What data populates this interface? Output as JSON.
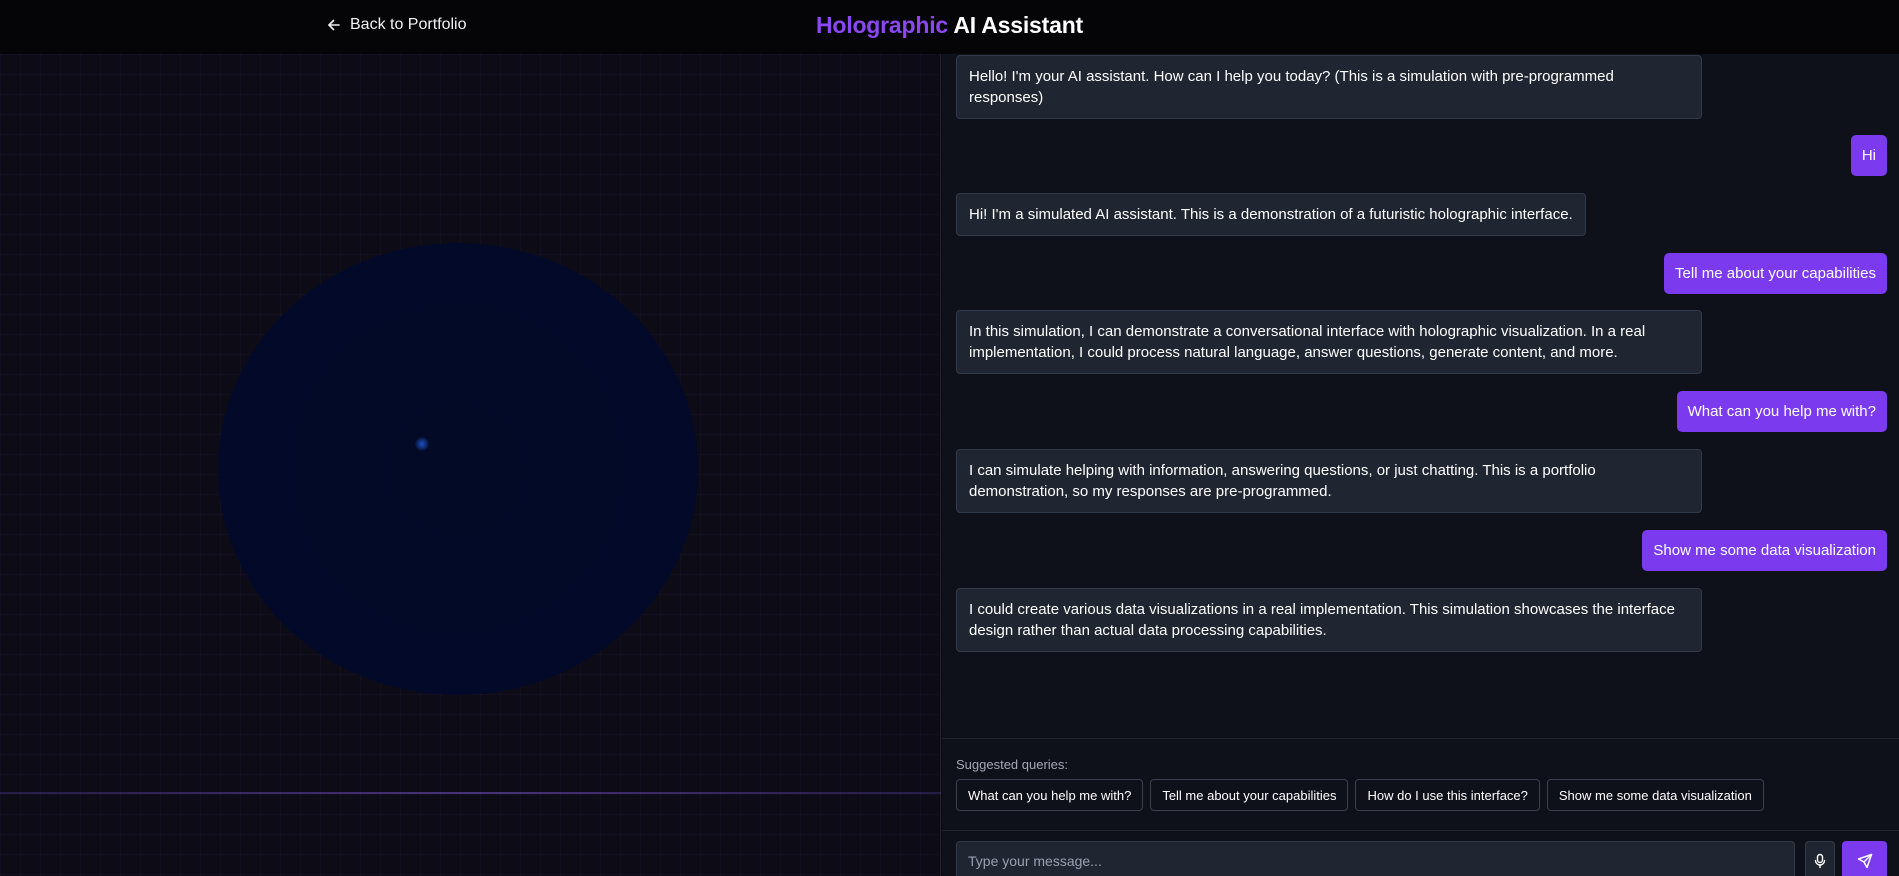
{
  "header": {
    "back_label": "Back to Portfolio",
    "title_accent": "Holographic",
    "title_rest": "AI Assistant"
  },
  "colors": {
    "accent": "#7b3aed",
    "title_accent": "#8b47f0",
    "ai_bubble": "#1f2531",
    "background": "#0b0b14"
  },
  "messages": [
    {
      "role": "ai",
      "text": "Hello! I'm your AI assistant. How can I help you today? (This is a simulation with pre-programmed responses)"
    },
    {
      "role": "user",
      "text": "Hi"
    },
    {
      "role": "ai",
      "text": "Hi! I'm a simulated AI assistant. This is a demonstration of a futuristic holographic interface."
    },
    {
      "role": "user",
      "text": "Tell me about your capabilities"
    },
    {
      "role": "ai",
      "text": "In this simulation, I can demonstrate a conversational interface with holographic visualization. In a real implementation, I could process natural language, answer questions, generate content, and more."
    },
    {
      "role": "user",
      "text": "What can you help me with?"
    },
    {
      "role": "ai",
      "text": "I can simulate helping with information, answering questions, or just chatting. This is a portfolio demonstration, so my responses are pre-programmed."
    },
    {
      "role": "user",
      "text": "Show me some data visualization"
    },
    {
      "role": "ai",
      "text": "I could create various data visualizations in a real implementation. This simulation showcases the interface design rather than actual data processing capabilities."
    }
  ],
  "suggestions": {
    "label": "Suggested queries:",
    "items": [
      "What can you help me with?",
      "Tell me about your capabilities",
      "How do I use this interface?",
      "Show me some data visualization"
    ]
  },
  "composer": {
    "placeholder": "Type your message...",
    "mic_icon": "microphone-icon",
    "send_icon": "send-icon"
  }
}
